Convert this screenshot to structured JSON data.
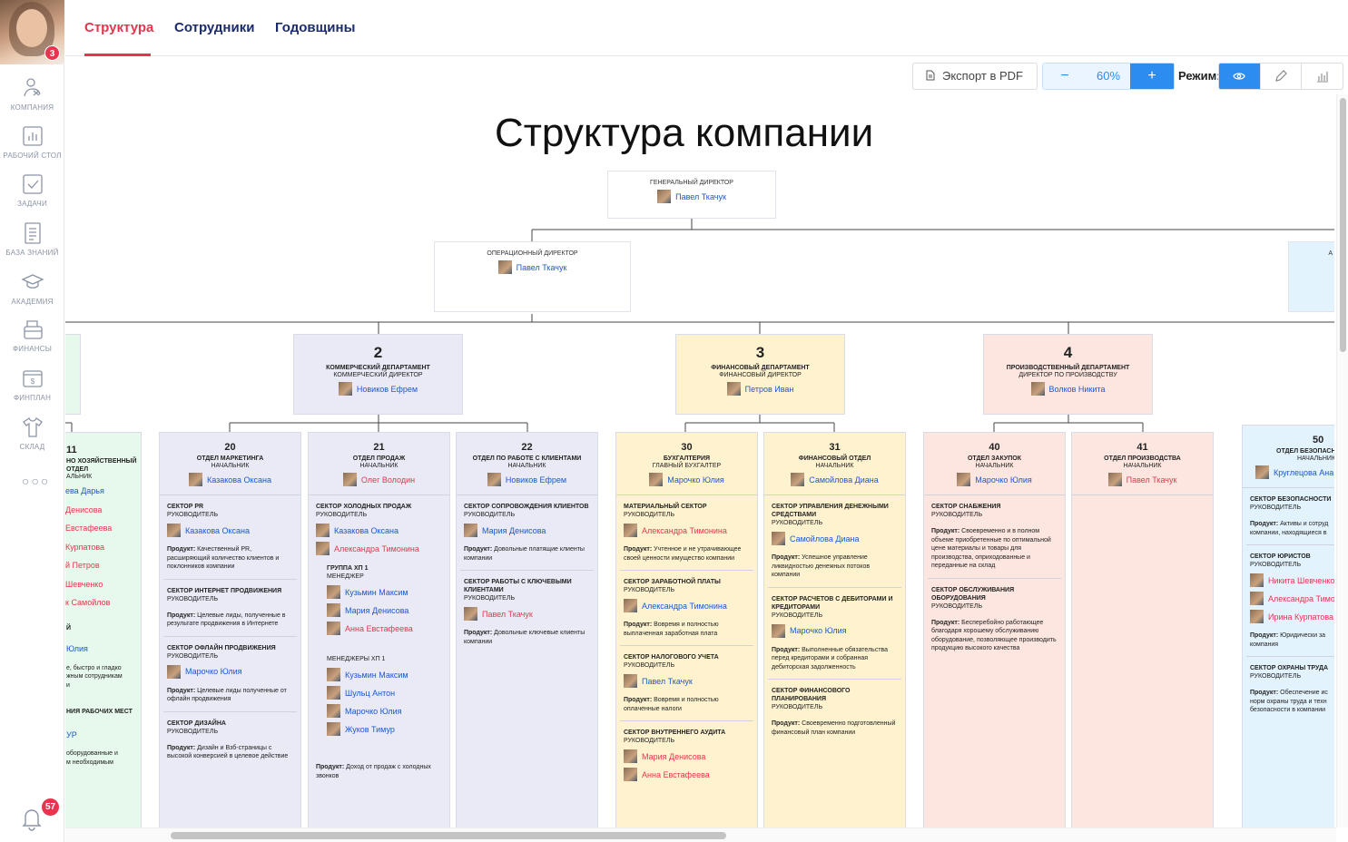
{
  "user": {
    "badge": "3"
  },
  "sidebar": {
    "items": [
      {
        "label": "Компания",
        "icon": "company-icon"
      },
      {
        "label": "Рабочий стол",
        "icon": "dashboard-icon"
      },
      {
        "label": "Задачи",
        "icon": "tasks-icon"
      },
      {
        "label": "База знаний",
        "icon": "knowledge-base-icon"
      },
      {
        "label": "Академия",
        "icon": "academy-icon"
      },
      {
        "label": "Финансы",
        "icon": "finance-icon"
      },
      {
        "label": "Финплан",
        "icon": "finplan-icon"
      },
      {
        "label": "Склад",
        "icon": "warehouse-icon"
      }
    ],
    "more": "○○○",
    "notifications": "57"
  },
  "tabs": [
    "Структура",
    "Сотрудники",
    "Годовщины"
  ],
  "toolbar": {
    "export_label": "Экспорт в PDF",
    "zoom_minus": "−",
    "zoom_value": "60%",
    "zoom_plus": "+",
    "mode_label": "Режим:"
  },
  "page_title": "Структура компании",
  "ceo": {
    "role": "Генеральный директор",
    "name": "Павел Ткачук"
  },
  "coo": {
    "role": "Операционный директор",
    "name": "Павел Ткачук"
  },
  "right_partial": {
    "role": "А"
  },
  "depts": [
    {
      "num": "2",
      "name": "Коммерческий департамент",
      "role": "Коммерческий директор",
      "person": "Новиков Ефрем"
    },
    {
      "num": "3",
      "name": "Финансовый департамент",
      "role": "Финансовый директор",
      "person": "Петров Иван"
    },
    {
      "num": "4",
      "name": "Производственный департамент",
      "role": "Директор по производству",
      "person": "Волков Никита"
    }
  ],
  "col11": {
    "num": "11",
    "name1": "но хозяйственный",
    "name2": "отдел",
    "role": "альник",
    "people": [
      "ева Дарья",
      "Денисова",
      "Евстафеева",
      "Курпатова",
      "й Петров",
      "Шевченко",
      "к Самойлов"
    ],
    "s2_title": "й",
    "s2_person": "Юлия",
    "s2_prod1": "е, быстро и гладко",
    "s2_prod2": "жным сотрудникам",
    "s2_prod3": "и",
    "s3_title": "ния рабочих мест",
    "s3_person": "УР",
    "s3_prod1": "оборудованные и",
    "s3_prod2": "м необходимым"
  },
  "col20": {
    "num": "20",
    "name": "Отдел маркетинга",
    "role": "Начальник",
    "person": "Казакова Оксана",
    "sections": [
      {
        "title": "Сектор PR",
        "role": "Руководитель",
        "person": "Казакова Оксана",
        "prod_label": "Продукт:",
        "prod": "Качественный PR, расширяющий количество клиентов и поклонников компании"
      },
      {
        "title": "Сектор интернет продвижения",
        "role": "Руководитель",
        "prod_label": "Продукт:",
        "prod": "Целевые лиды, полученные в результате продвижения в Интернете"
      },
      {
        "title": "Сектор офлайн продвижения",
        "role": "Руководитель",
        "person": "Марочко Юлия",
        "prod_label": "Продукт:",
        "prod": "Целевые лиды полученные от офлайн продвижения"
      },
      {
        "title": "Сектор дизайна",
        "role": "Руководитель",
        "prod_label": "Продукт:",
        "prod": "Дизайн и Взб-страницы с высокой конверсией в целевое действие"
      }
    ]
  },
  "col21": {
    "num": "21",
    "name": "Отдел продаж",
    "role": "Начальник",
    "person": "Олег Володин",
    "sec1_title": "Сектор холодных продаж",
    "sec1_role": "Руководитель",
    "sec1_p1": "Казакова Оксана",
    "sec1_p2": "Александра Тимонина",
    "group_title": "Группа ХП 1",
    "group_role": "Менеджер",
    "group_people": [
      "Кузьмин Максим",
      "Мария Денисова",
      "Анна Евстафеева"
    ],
    "managers_title": "Менеджеры ХП 1",
    "managers": [
      "Кузьмин Максим",
      "Шульц Антон",
      "Марочко Юлия",
      "Жуков Тимур"
    ],
    "prod_label": "Продукт:",
    "prod": "Доход от продаж с холодных звонков"
  },
  "col22": {
    "num": "22",
    "name": "Отдел по работе с клиентами",
    "role": "Начальник",
    "person": "Новиков Ефрем",
    "sections": [
      {
        "title": "Сектор сопровождения клиентов",
        "role": "Руководитель",
        "person": "Мария Денисова",
        "prod_label": "Продукт:",
        "prod": "Довольные платящие клиенты компании"
      },
      {
        "title": "Сектор работы с ключевыми клиентами",
        "role": "Руководитель",
        "person": "Павел Ткачук",
        "prod_label": "Продукт:",
        "prod": "Довольные ключевые клиенты компании"
      }
    ]
  },
  "col30": {
    "num": "30",
    "name": "Бухгалтерия",
    "role": "Главный бухгалтер",
    "person": "Марочко Юлия",
    "sections": [
      {
        "title": "Материальный сектор",
        "role": "Руководитель",
        "person": "Александра Тимонина",
        "prod_label": "Продукт:",
        "prod": "Учтенное и не утрачивающее своей ценности имущество компании"
      },
      {
        "title": "Сектор заработной платы",
        "role": "Руководитель",
        "person": "Александра Тимонина",
        "prod_label": "Продукт:",
        "prod": "Вовремя и полностью выплаченная заработная плата"
      },
      {
        "title": "Сектор налогового учета",
        "role": "Руководитель",
        "person": "Павел Ткачук",
        "prod_label": "Продукт:",
        "prod": "Вовремя и полностью оплаченные налоги"
      },
      {
        "title": "Сектор внутреннего аудита",
        "role": "Руководитель",
        "person": "Мария Денисова",
        "person2": "Анна Евстафеева"
      }
    ]
  },
  "col31": {
    "num": "31",
    "name": "Финансовый отдел",
    "role": "Начальник",
    "person": "Самойлова Диана",
    "sections": [
      {
        "title": "Сектор управления денежными средствами",
        "role": "Руководитель",
        "person": "Самойлова Диана",
        "prod_label": "Продукт:",
        "prod": "Успешное управление ликвидностью денежных потоков компании"
      },
      {
        "title": "Сектор расчетов с дебиторами и кредиторами",
        "role": "Руководитель",
        "person": "Марочко Юлия",
        "prod_label": "Продукт:",
        "prod": "Выполненные обязательства перед кредиторами и собранная дебиторская задолженность"
      },
      {
        "title": "Сектор финансового планирования",
        "role": "Руководитель",
        "prod_label": "Продукт:",
        "prod": "Своевременно подготовленный финансовый план компании"
      }
    ]
  },
  "col40": {
    "num": "40",
    "name": "Отдел закупок",
    "role": "Начальник",
    "person": "Марочко Юлия",
    "sections": [
      {
        "title": "Сектор снабжения",
        "role": "Руководитель",
        "prod_label": "Продукт:",
        "prod": "Своевременно и в полном объеме приобретенные по оптимальной цене материалы и товары для производства, оприходованные и переданные на склад"
      },
      {
        "title": "Сектор обслуживания оборудования",
        "role": "Руководитель",
        "prod_label": "Продукт:",
        "prod": "Бесперебойно работающее благодаря хорошему обслуживанию оборудование, позволяющее производить продукцию высокого качества"
      }
    ]
  },
  "col41": {
    "num": "41",
    "name": "Отдел производства",
    "role": "Начальник",
    "person": "Павел Ткачук"
  },
  "col50": {
    "num": "50",
    "name": "Отдел безопасн",
    "role": "Начальник",
    "person": "Круглецова Ана",
    "sec1_title": "Сектор безопасности",
    "sec1_role": "Руководитель",
    "sec1_prod_label": "Продукт:",
    "sec1_prod1": "Активы и сотруд",
    "sec1_prod2": "компании, находящиеся в",
    "sec2_title": "Сектор юристов",
    "sec2_role": "Руководитель",
    "sec2_people": [
      "Никита Шевченко",
      "Александра Тимо",
      "Ирина Курпатова"
    ],
    "sec2_prod_label": "Продукт:",
    "sec2_prod1": "Юридически за",
    "sec2_prod2": "компания",
    "sec3_title": "Сектор охраны труда",
    "sec3_role": "Руководитель",
    "sec3_prod_label": "Продукт:",
    "sec3_prod1": "Обеспечение ис",
    "sec3_prod2": "норм охраны труда и техн",
    "sec3_prod3": "безопасности в компании"
  },
  "colors": {
    "accent": "#e8344e",
    "primary": "#2d8cf0",
    "link": "#1a57d6"
  }
}
